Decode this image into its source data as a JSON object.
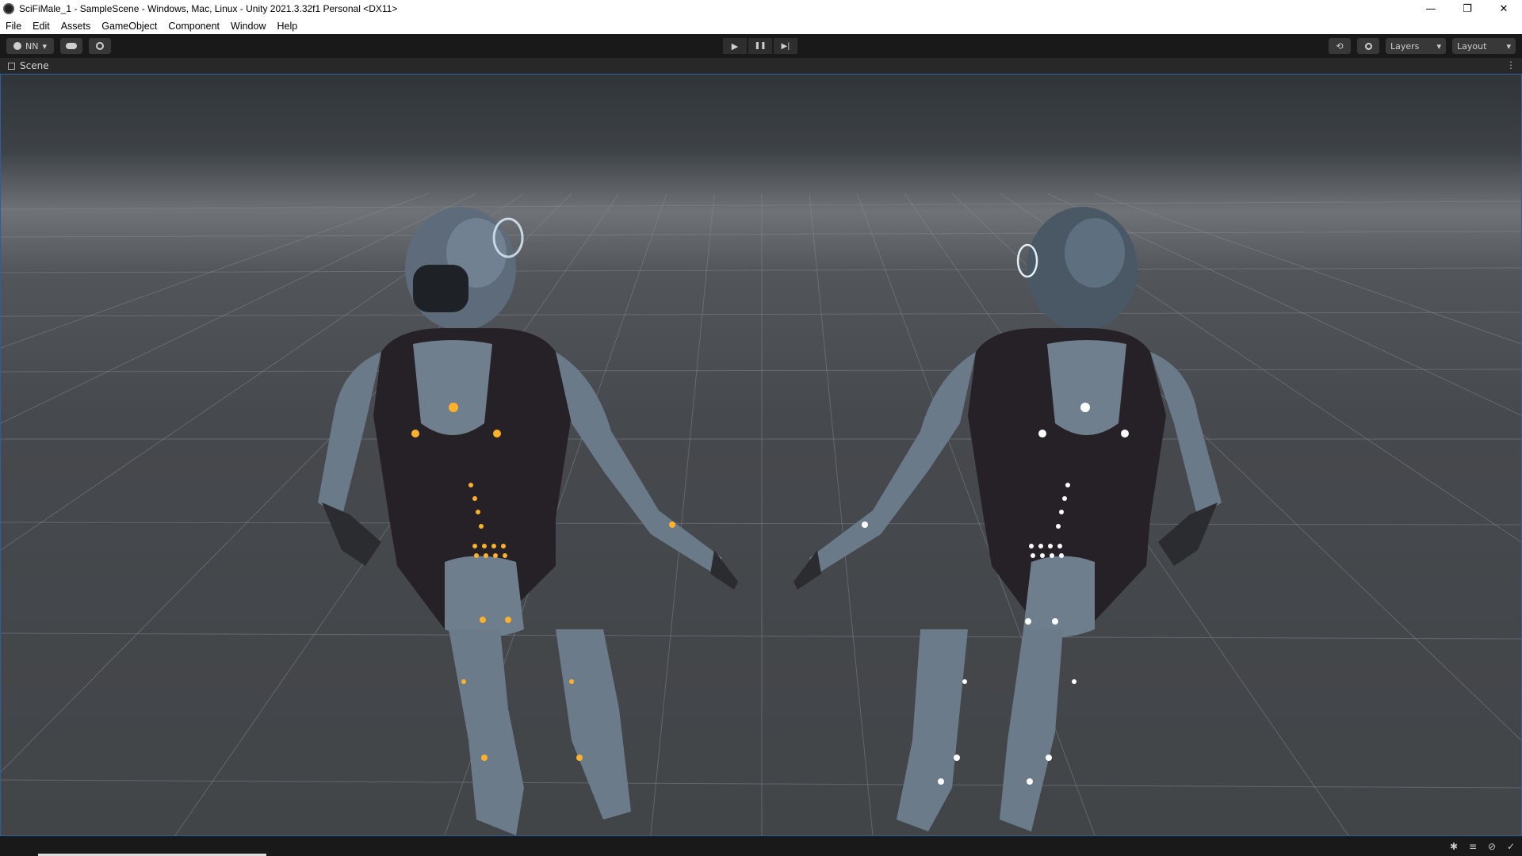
{
  "window": {
    "title": "SciFiMale_1 - SampleScene - Windows, Mac, Linux - Unity 2021.3.32f1 Personal <DX11>",
    "controls": {
      "minimize": "—",
      "restore": "❐",
      "close": "✕"
    }
  },
  "menu": [
    "File",
    "Edit",
    "Assets",
    "GameObject",
    "Component",
    "Window",
    "Help"
  ],
  "toolbar": {
    "account_label": "NN",
    "account_icon": "account-icon",
    "cloud_icon": "cloud-icon",
    "collab_icon": "collab-icon",
    "play_icon": "▶",
    "pause_icon": "❚❚",
    "step_icon": "▶|",
    "history_icon": "⟲",
    "search_icon": "🔍",
    "layers_label": "Layers",
    "layout_label": "Layout",
    "dropdown_glyph": "▾"
  },
  "scene_tab": {
    "label": "Scene",
    "menu_glyph": "⋮"
  },
  "status_icons": [
    "bug-icon",
    "stack-icon",
    "network-icon",
    "check-icon"
  ],
  "colors": {
    "accent_border": "#2e5f9a",
    "glow_left": "#ffb12a",
    "glow_right": "#ffffff"
  }
}
